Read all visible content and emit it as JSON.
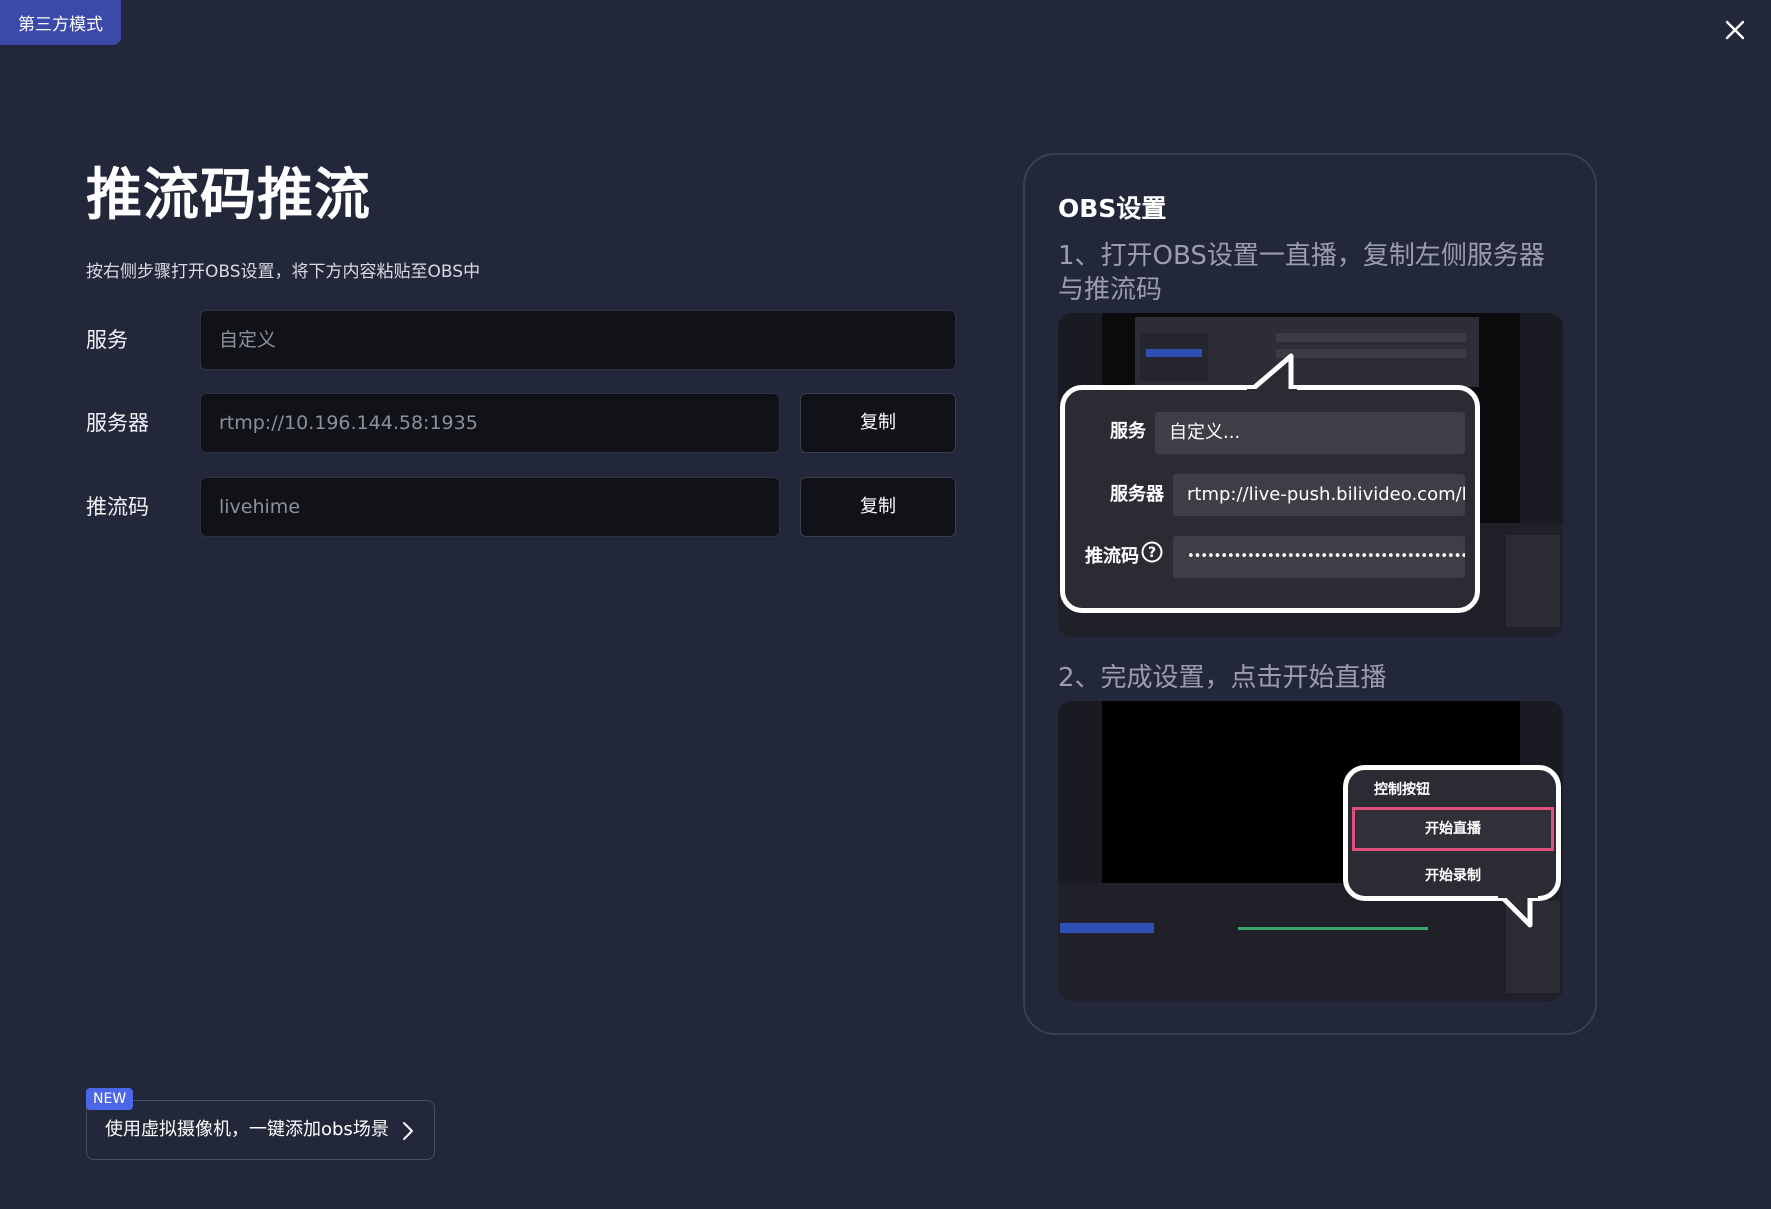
{
  "mode_badge": "第三方模式",
  "title": "推流码推流",
  "subtitle": "按右侧步骤打开OBS设置，将下方内容粘贴至OBS中",
  "form": {
    "service_label": "服务",
    "service_value": "自定义",
    "server_label": "服务器",
    "server_value": "rtmp://10.196.144.58:1935",
    "stream_key_label": "推流码",
    "stream_key_value": "livehime",
    "copy_label": "复制"
  },
  "guide": {
    "title": "OBS设置",
    "step1": "1、打开OBS设置一直播，复制左侧服务器与推流码",
    "step2": "2、完成设置，点击开始直播",
    "shot1": {
      "service_label": "服务",
      "service_value": "自定义...",
      "server_label": "服务器",
      "server_value": "rtmp://live-push.bilivideo.com/live-",
      "key_label": "推流码",
      "key_value": "••••••••••••••••••••••••••••••••••••••••••••"
    },
    "shot2": {
      "controls_title": "控制按钮",
      "start_stream": "开始直播",
      "start_record": "开始录制"
    }
  },
  "new_badge": "NEW",
  "virtual_cam": "使用虚拟摄像机，一键添加obs场景",
  "colors": {
    "background": "#23273a",
    "badge": "#3b4aa8",
    "new_badge": "#4b67e8",
    "highlight": "#e0507a"
  }
}
